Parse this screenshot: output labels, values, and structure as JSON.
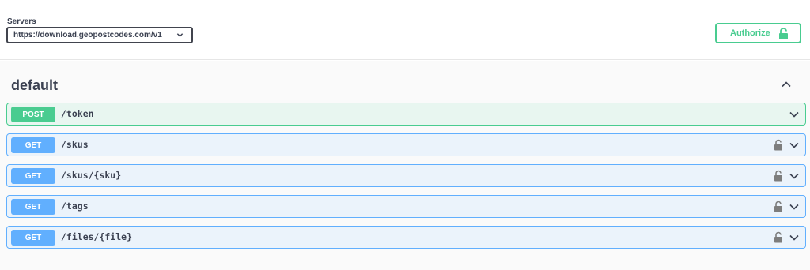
{
  "servers": {
    "label": "Servers",
    "selected": "https://download.geopostcodes.com/v1"
  },
  "authorize": {
    "label": "Authorize",
    "color": "#49cc90"
  },
  "section": {
    "title": "default"
  },
  "operations": [
    {
      "method": "POST",
      "path": "/token",
      "locked": false
    },
    {
      "method": "GET",
      "path": "/skus",
      "locked": true
    },
    {
      "method": "GET",
      "path": "/skus/{sku}",
      "locked": true
    },
    {
      "method": "GET",
      "path": "/tags",
      "locked": true
    },
    {
      "method": "GET",
      "path": "/files/{file}",
      "locked": true
    }
  ],
  "colors": {
    "post": "#49cc90",
    "get": "#61affe"
  }
}
